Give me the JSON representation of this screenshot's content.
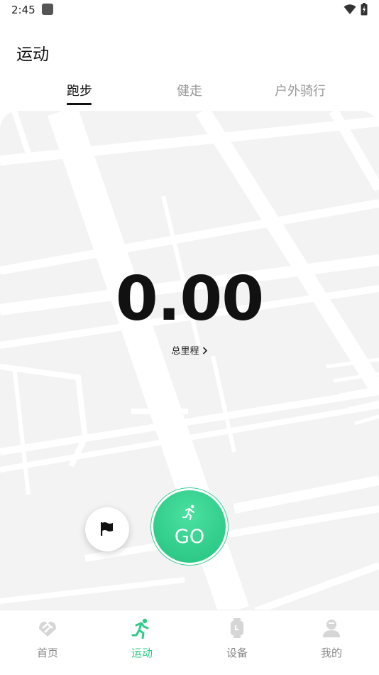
{
  "status_bar": {
    "time": "2:45"
  },
  "header": {
    "title": "运动"
  },
  "tabs": [
    {
      "label": "跑步",
      "active": true
    },
    {
      "label": "健走",
      "active": false
    },
    {
      "label": "户外骑行",
      "active": false
    }
  ],
  "summary": {
    "distance_value": "0.00",
    "distance_label": "总里程"
  },
  "actions": {
    "go_label": "GO"
  },
  "bottom_nav": [
    {
      "label": "首页",
      "icon": "home-icon",
      "active": false
    },
    {
      "label": "运动",
      "icon": "runner-icon",
      "active": true
    },
    {
      "label": "设备",
      "icon": "watch-icon",
      "active": false
    },
    {
      "label": "我的",
      "icon": "profile-icon",
      "active": false
    }
  ],
  "colors": {
    "accent": "#2fcb88",
    "map_bg": "#f3f3f3",
    "map_road": "#ffffff"
  }
}
